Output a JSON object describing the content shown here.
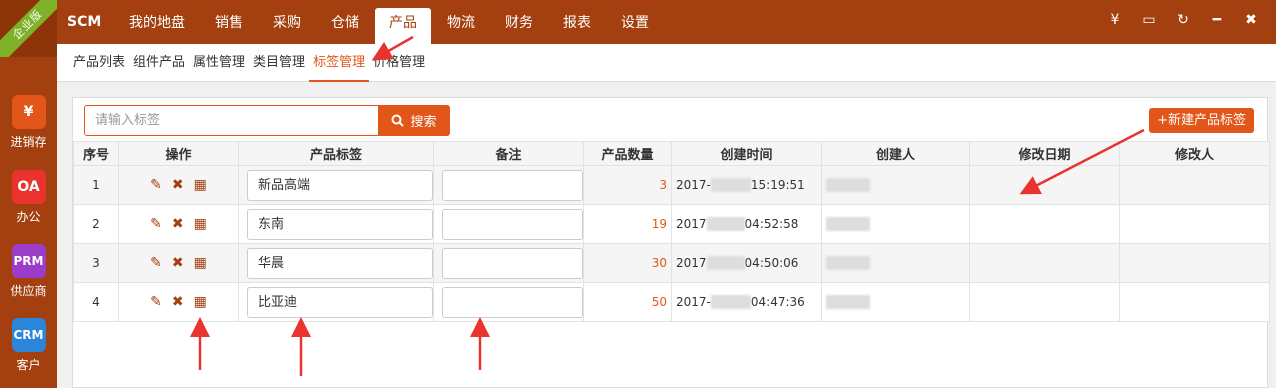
{
  "rail": {
    "ribbon": "企业版",
    "apps": [
      {
        "tile": "¥",
        "label": "进销存",
        "color": "#e2561a"
      },
      {
        "tile": "OA",
        "label": "办公",
        "color": "#e8332e"
      },
      {
        "tile": "PRM",
        "label": "供应商",
        "color": "#9b3dc9"
      },
      {
        "tile": "CRM",
        "label": "客户",
        "color": "#2b86d9"
      }
    ]
  },
  "topbar": {
    "brand": "SCM",
    "nav": [
      "我的地盘",
      "销售",
      "采购",
      "仓储",
      "产品",
      "物流",
      "财务",
      "报表",
      "设置"
    ],
    "active_nav": "产品",
    "icons": [
      "yen-icon",
      "message-icon",
      "refresh-icon",
      "minimize-icon",
      "close-icon"
    ],
    "icon_glyphs": [
      "¥",
      "▭",
      "↻",
      "━",
      "✖"
    ]
  },
  "subnav": {
    "items": [
      "产品列表",
      "组件产品",
      "属性管理",
      "类目管理",
      "标签管理",
      "价格管理"
    ],
    "active": "标签管理"
  },
  "toolbar": {
    "search_placeholder": "请输入标签",
    "search_label": "搜索",
    "new_label": "+新建产品标签"
  },
  "table": {
    "headers": [
      "序号",
      "操作",
      "产品标签",
      "备注",
      "产品数量",
      "创建时间",
      "创建人",
      "修改日期",
      "修改人"
    ],
    "rows": [
      {
        "index": "1",
        "tag": "新品高端",
        "note": "",
        "count": "3",
        "created_date": "2017-",
        "created_time": "15:19:51"
      },
      {
        "index": "2",
        "tag": "东南",
        "note": "",
        "count": "19",
        "created_date": "2017",
        "created_time": "04:52:58"
      },
      {
        "index": "3",
        "tag": "华晨",
        "note": "",
        "count": "30",
        "created_date": "2017",
        "created_time": "04:50:06"
      },
      {
        "index": "4",
        "tag": "比亚迪",
        "note": "",
        "count": "50",
        "created_date": "2017-",
        "created_time": "04:47:36"
      }
    ]
  },
  "colors": {
    "brand": "#a4400f",
    "accent": "#e2561a",
    "annotation": "#e8332e"
  }
}
